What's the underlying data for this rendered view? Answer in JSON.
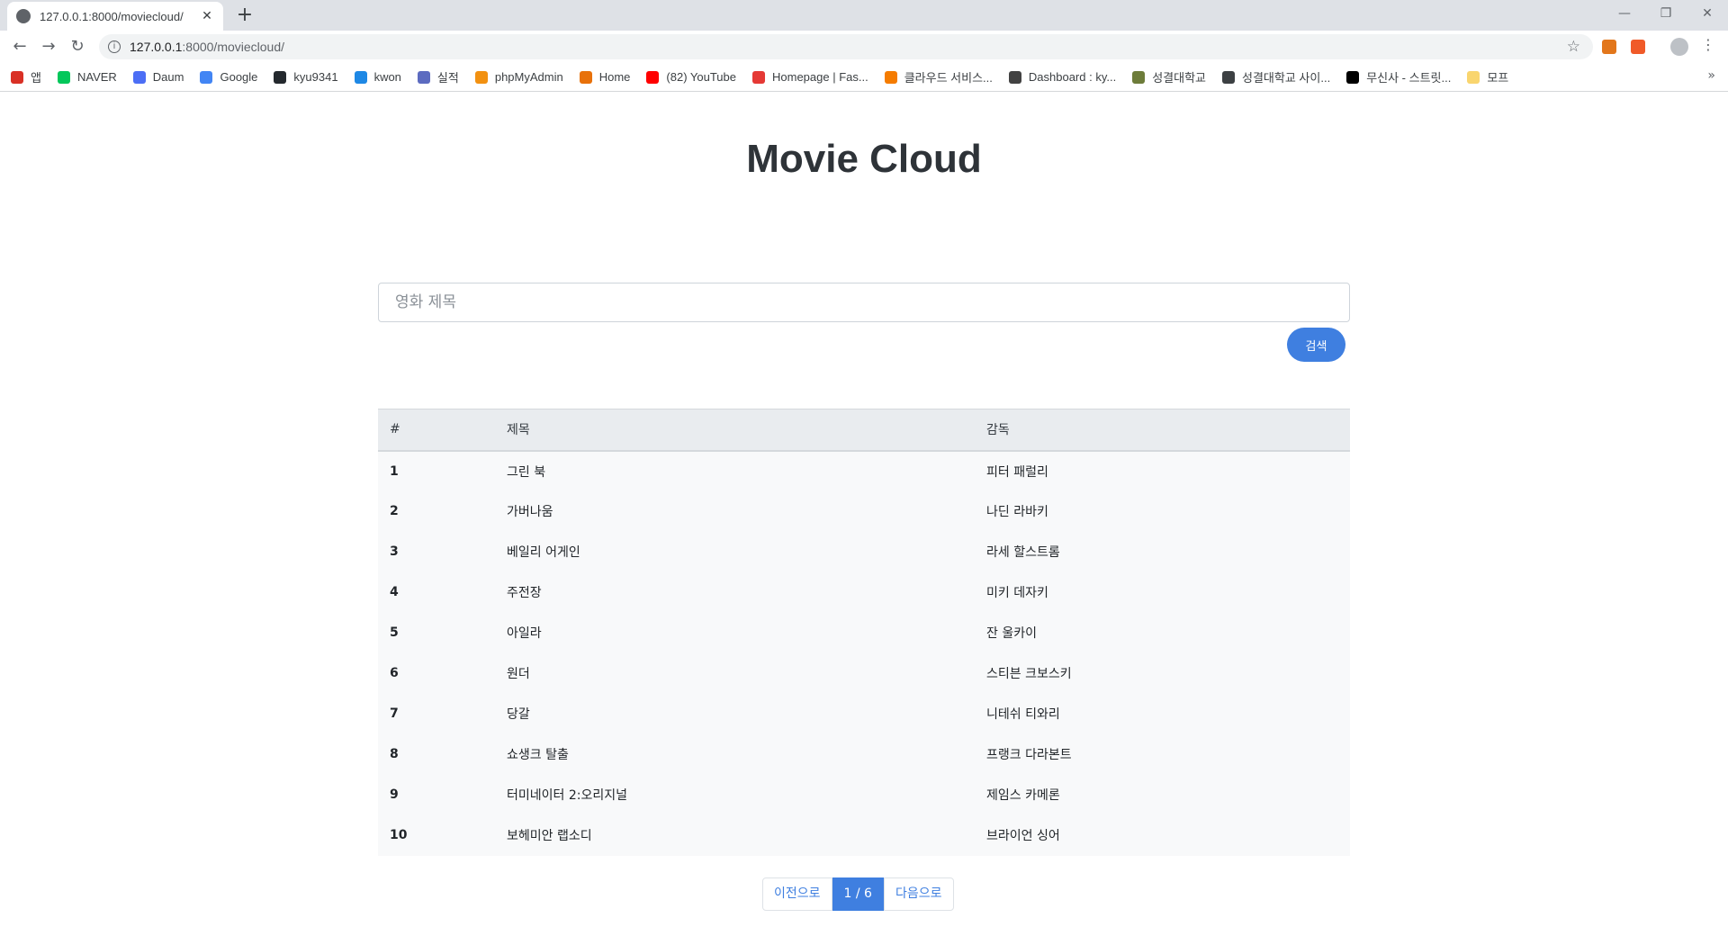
{
  "browser": {
    "tab_title": "127.0.0.1:8000/moviecloud/",
    "tab_close": "✕",
    "new_tab": "+",
    "url_host": "127.0.0.1",
    "url_path": ":8000/moviecloud/",
    "window_controls": {
      "minimize": "—",
      "restore": "❐",
      "close": "✕"
    },
    "bookmarks": [
      {
        "label": "앱",
        "icon": "apps-grid-icon",
        "color": "#d93025"
      },
      {
        "label": "NAVER",
        "icon": "naver-icon",
        "color": "#03c75a"
      },
      {
        "label": "Daum",
        "icon": "daum-icon",
        "color": "#4c6ef5"
      },
      {
        "label": "Google",
        "icon": "google-icon",
        "color": "#4285f4"
      },
      {
        "label": "kyu9341",
        "icon": "github-icon",
        "color": "#24292e"
      },
      {
        "label": "kwon",
        "icon": "kwon-icon",
        "color": "#1e88e5"
      },
      {
        "label": "실적",
        "icon": "record-icon",
        "color": "#5c6bc0"
      },
      {
        "label": "phpMyAdmin",
        "icon": "phpmyadmin-icon",
        "color": "#f29111"
      },
      {
        "label": "Home",
        "icon": "home-ring-icon",
        "color": "#e8710a"
      },
      {
        "label": "(82) YouTube",
        "icon": "youtube-icon",
        "color": "#ff0000"
      },
      {
        "label": "Homepage | Fas...",
        "icon": "fastcampus-icon",
        "color": "#e53935"
      },
      {
        "label": "클라우드 서비스...",
        "icon": "cloud-box-icon",
        "color": "#f57c00"
      },
      {
        "label": "Dashboard : ky...",
        "icon": "dashboard-icon",
        "color": "#424242"
      },
      {
        "label": "성결대학교",
        "icon": "university-emblem-icon",
        "color": "#6d7c3a"
      },
      {
        "label": "성결대학교 사이...",
        "icon": "globe-icon",
        "color": "#3c4043"
      },
      {
        "label": "무신사 - 스트릿...",
        "icon": "musinsa-icon",
        "color": "#000000"
      },
      {
        "label": "모프",
        "icon": "folder-icon",
        "color": "#f9d56e"
      }
    ],
    "bookmarks_more": "»"
  },
  "page": {
    "title": "Movie Cloud",
    "search": {
      "placeholder": "영화 제목",
      "value": "",
      "button_label": "검색"
    },
    "table": {
      "headers": [
        "#",
        "제목",
        "감독"
      ],
      "rows": [
        {
          "num": "1",
          "title": "그린 북",
          "director": "피터 패럴리"
        },
        {
          "num": "2",
          "title": "가버나움",
          "director": "나딘 라바키"
        },
        {
          "num": "3",
          "title": "베일리 어게인",
          "director": "라세 할스트롬"
        },
        {
          "num": "4",
          "title": "주전장",
          "director": "미키 데자키"
        },
        {
          "num": "5",
          "title": "아일라",
          "director": "잔 울카이"
        },
        {
          "num": "6",
          "title": "원더",
          "director": "스티븐 크보스키"
        },
        {
          "num": "7",
          "title": "당갈",
          "director": "니테쉬 티와리"
        },
        {
          "num": "8",
          "title": "쇼생크 탈출",
          "director": "프랭크 다라본트"
        },
        {
          "num": "9",
          "title": "터미네이터 2:오리지널",
          "director": "제임스 카메론"
        },
        {
          "num": "10",
          "title": "보헤미안 랩소디",
          "director": "브라이언 싱어"
        }
      ]
    },
    "pagination": {
      "prev_label": "이전으로",
      "current": "1 / 6",
      "next_label": "다음으로"
    }
  },
  "colors": {
    "accent": "#3f7fe0",
    "header_bg": "#e9ecef",
    "row_bg": "#f8f9fa"
  }
}
